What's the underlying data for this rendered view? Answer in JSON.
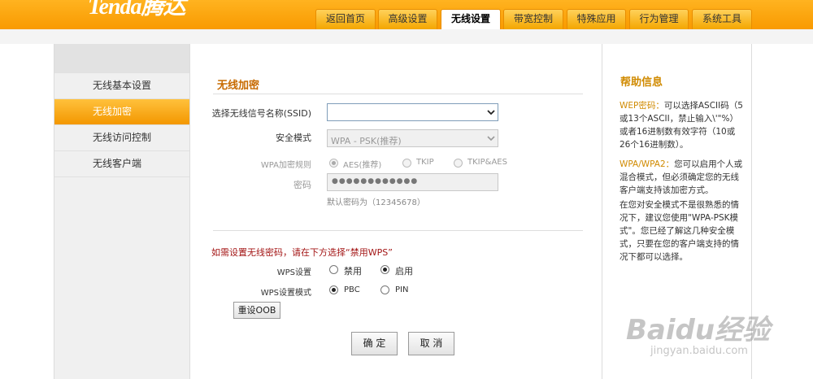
{
  "header": {
    "logo_text": "Tenda腾达",
    "tabs": [
      {
        "label": "返回首页"
      },
      {
        "label": "高级设置"
      },
      {
        "label": "无线设置"
      },
      {
        "label": "带宽控制"
      },
      {
        "label": "特殊应用"
      },
      {
        "label": "行为管理"
      },
      {
        "label": "系统工具"
      }
    ],
    "active_tab": "无线设置"
  },
  "sidebar": {
    "items": [
      {
        "label": "无线基本设置"
      },
      {
        "label": "无线加密"
      },
      {
        "label": "无线访问控制"
      },
      {
        "label": "无线客户端"
      }
    ],
    "active_item": "无线加密"
  },
  "main": {
    "section_title": "无线加密",
    "ssid_label": "选择无线信号名称(SSID)",
    "ssid_value": "",
    "security_mode_label": "安全模式",
    "security_mode_value": "WPA - PSK(推荐)",
    "wpa_rule_label": "WPA加密规则",
    "wpa_options": [
      "AES(推荐)",
      "TKIP",
      "TKIP&AES"
    ],
    "wpa_selected": "AES(推荐)",
    "password_label": "密码",
    "password_value": "●●●●●●●●●●●●",
    "password_hint": "默认密码为（12345678）",
    "wps_note": "如需设置无线密码，请在下方选择“禁用WPS”",
    "wps_setting_label": "WPS设置",
    "wps_setting_options": [
      "禁用",
      "启用"
    ],
    "wps_setting_selected": "启用",
    "wps_mode_label": "WPS设置模式",
    "wps_mode_options": [
      "PBC",
      "PIN"
    ],
    "wps_mode_selected": "PBC",
    "reset_oob_label": "重设OOB",
    "confirm_label": "确 定",
    "cancel_label": "取 消"
  },
  "help": {
    "title": "帮助信息",
    "wep_key": "WEP密码：",
    "wep_text": "可以选择ASCII码（5或13个ASCII，禁止输入\\'\"%）或者16进制数有效字符（10或26个16进制数）。",
    "wpa_key": "WPA/WPA2：",
    "wpa_text": "您可以启用个人或混合模式，但必须确定您的无线客户端支持该加密方式。",
    "extra_text": "在您对安全模式不是很熟悉的情况下，建议您使用\"WPA-PSK模式\"。您已经了解这几种安全模式，只要在您的客户端支持的情况下都可以选择。"
  },
  "watermark": {
    "brand": "Baidu经验",
    "url": "jingyan.baidu.com"
  },
  "colors": {
    "header_orange": "#f99a00",
    "accent_text": "#c76a00",
    "wps_note": "#a31515",
    "help_title": "#d08a00"
  }
}
